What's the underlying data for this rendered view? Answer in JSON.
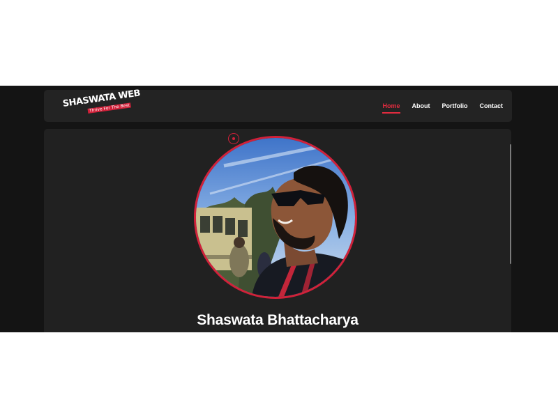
{
  "logo": {
    "main_text": "SHASWATA WEB",
    "tagline": "Thrive For The Best"
  },
  "nav": {
    "items": [
      {
        "label": "Home",
        "active": true
      },
      {
        "label": "About",
        "active": false
      },
      {
        "label": "Portfolio",
        "active": false
      },
      {
        "label": "Contact",
        "active": false
      }
    ]
  },
  "profile": {
    "name": "Shaswata Bhattacharya"
  },
  "colors": {
    "accent": "#e32b3f",
    "page_background": "#141414",
    "card_background": "#212121",
    "navbar_background": "#232323"
  }
}
